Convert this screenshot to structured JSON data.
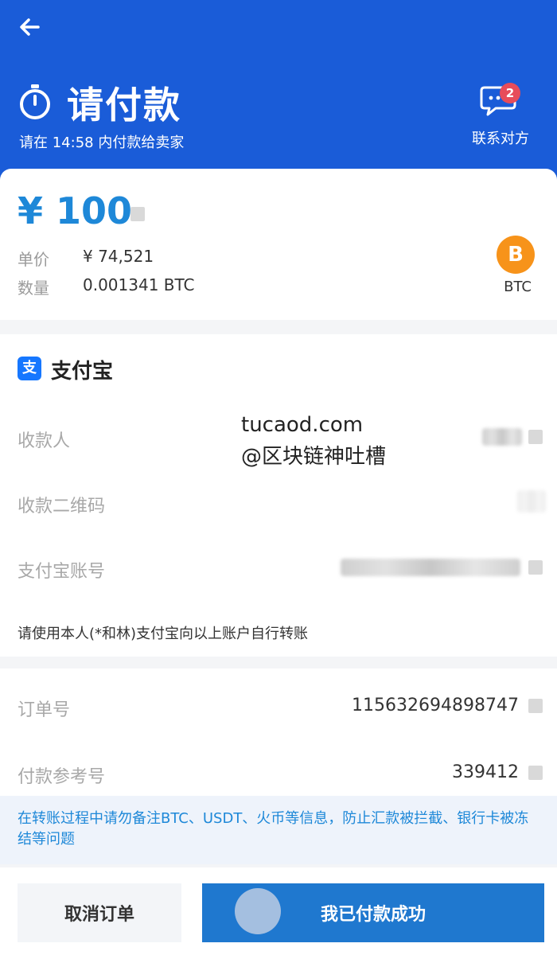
{
  "header": {
    "title": "请付款",
    "subtitle": "请在 14:58 内付款给卖家",
    "contact_label": "联系对方",
    "contact_badge": "2"
  },
  "summary": {
    "amount": "¥ 100",
    "price_label": "单价",
    "price_value": "¥ 74,521",
    "qty_label": "数量",
    "qty_value": "0.001341 BTC",
    "coin_symbol": "B",
    "coin_label": "BTC"
  },
  "payment": {
    "method_icon": "支",
    "method_name": "支付宝",
    "payee_label": "收款人",
    "qr_label": "收款二维码",
    "account_label": "支付宝账号",
    "note": "请使用本人(*和林)支付宝向以上账户自行转账"
  },
  "watermark": {
    "line1": "tucaod.com",
    "line2": "@区块链神吐槽"
  },
  "order": {
    "order_no_label": "订单号",
    "order_no": "115632694898747",
    "ref_label": "付款参考号",
    "ref_no": "339412"
  },
  "warning": "在转账过程中请勿备注BTC、USDT、火币等信息，防止汇款被拦截、银行卡被冻结等问题",
  "actions": {
    "cancel": "取消订单",
    "confirm": "我已付款成功"
  },
  "colors": {
    "header_bg": "#1a5cd8",
    "accent": "#1e88d8",
    "bitcoin": "#f7931a",
    "badge": "#e74c5a"
  }
}
